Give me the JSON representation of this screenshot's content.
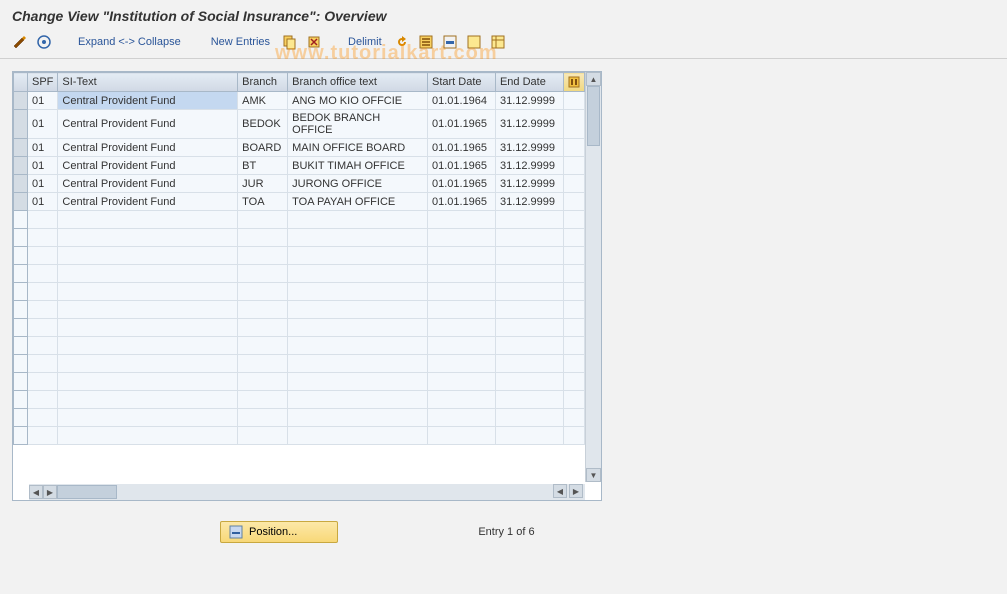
{
  "title": "Change View \"Institution of Social Insurance\": Overview",
  "toolbar": {
    "expand_collapse": "Expand <-> Collapse",
    "new_entries": "New Entries",
    "delimit": "Delimit"
  },
  "watermark": "www.tutorialkart.com",
  "columns": {
    "spf": "SPF",
    "sitext": "SI-Text",
    "branch": "Branch",
    "botext": "Branch office text",
    "start": "Start Date",
    "end": "End Date"
  },
  "rows": [
    {
      "spf": "01",
      "sitext": "Central Provident Fund",
      "branch": "AMK",
      "botext": "ANG MO KIO OFFCIE",
      "start": "01.01.1964",
      "end": "31.12.9999"
    },
    {
      "spf": "01",
      "sitext": "Central Provident Fund",
      "branch": "BEDOK",
      "botext": "BEDOK BRANCH OFFICE",
      "start": "01.01.1965",
      "end": "31.12.9999"
    },
    {
      "spf": "01",
      "sitext": "Central Provident Fund",
      "branch": "BOARD",
      "botext": "MAIN OFFICE BOARD",
      "start": "01.01.1965",
      "end": "31.12.9999"
    },
    {
      "spf": "01",
      "sitext": "Central Provident Fund",
      "branch": "BT",
      "botext": "BUKIT TIMAH OFFICE",
      "start": "01.01.1965",
      "end": "31.12.9999"
    },
    {
      "spf": "01",
      "sitext": "Central Provident Fund",
      "branch": "JUR",
      "botext": "JURONG OFFICE",
      "start": "01.01.1965",
      "end": "31.12.9999"
    },
    {
      "spf": "01",
      "sitext": "Central Provident Fund",
      "branch": "TOA",
      "botext": "TOA PAYAH OFFICE",
      "start": "01.01.1965",
      "end": "31.12.9999"
    }
  ],
  "footer": {
    "position_label": "Position...",
    "entry_text": "Entry 1 of 6"
  }
}
